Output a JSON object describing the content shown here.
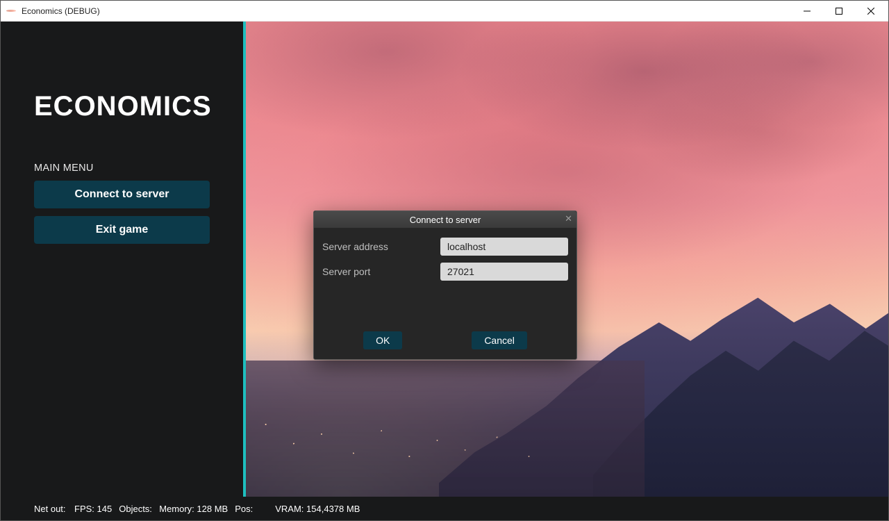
{
  "window": {
    "title": "Economics (DEBUG)"
  },
  "sidebar": {
    "game_title": "ECONOMICS",
    "menu_label": "MAIN MENU",
    "connect_label": "Connect to server",
    "exit_label": "Exit game"
  },
  "modal": {
    "title": "Connect to server",
    "address_label": "Server address",
    "address_value": "localhost",
    "port_label": "Server port",
    "port_value": "27021",
    "ok_label": "OK",
    "cancel_label": "Cancel"
  },
  "status": {
    "netout_key": "Net out:",
    "fps_key": "FPS:",
    "fps_val": "145",
    "objects_key": "Objects:",
    "memory_key": "Memory:",
    "memory_val": "128 MB",
    "pos_key": "Pos:",
    "vram_key": "VRAM:",
    "vram_val": "154,4378 MB"
  }
}
